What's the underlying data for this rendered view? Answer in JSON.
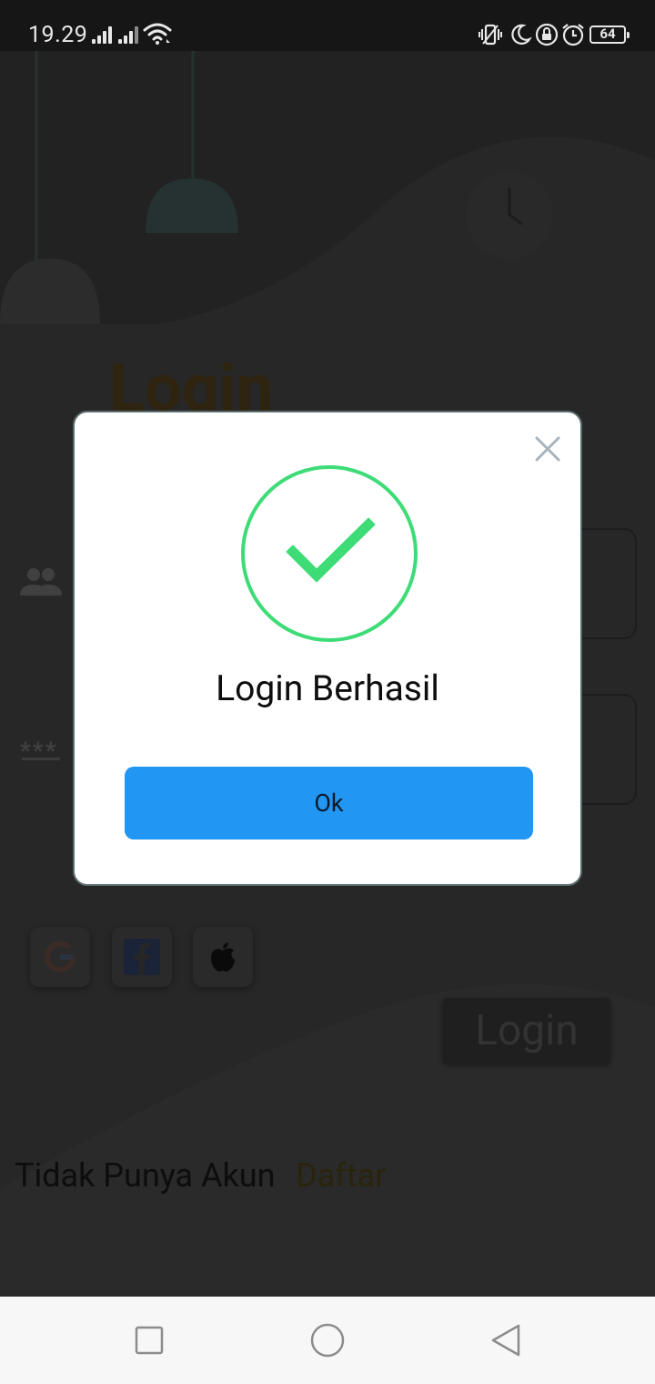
{
  "status_bar": {
    "time": "19.29",
    "battery": "64",
    "icons": [
      "signal-icon",
      "signal-icon",
      "wifi-icon",
      "vibrate-icon",
      "do-not-disturb-icon",
      "rotation-lock-icon",
      "alarm-icon",
      "battery-icon"
    ]
  },
  "background": {
    "title": "Login",
    "login_button": "Login",
    "no_account_text": "Tidak Punya Akun",
    "register_link": "Daftar",
    "social_buttons": [
      "google-icon",
      "facebook-icon",
      "apple-icon"
    ]
  },
  "dialog": {
    "message": "Login Berhasil",
    "ok_label": "Ok",
    "colors": {
      "success": "#3ddc76",
      "button": "#2196f3"
    }
  },
  "nav_bar": {
    "buttons": [
      "recents",
      "home",
      "back"
    ]
  }
}
